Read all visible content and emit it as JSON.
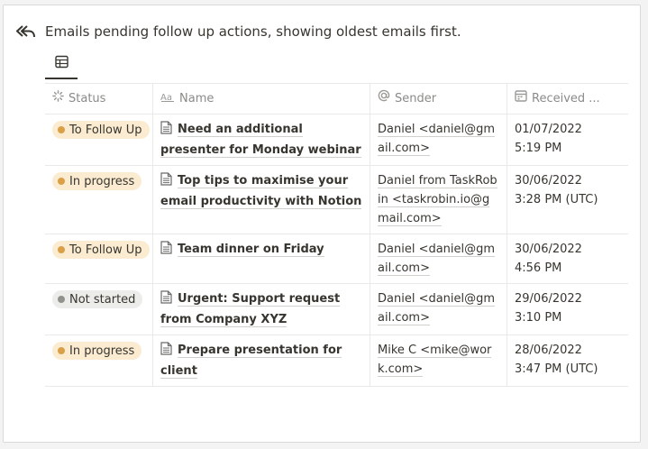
{
  "header": {
    "title": "Emails pending follow up actions, showing oldest emails first."
  },
  "icons": {
    "back": "reply-all-icon",
    "table_view": "table-icon",
    "status": "status-icon",
    "name": "text-icon",
    "sender": "at-sign-icon",
    "received": "calendar-icon",
    "page": "page-icon"
  },
  "columns": {
    "status": "Status",
    "name": "Name",
    "sender": "Sender",
    "received": "Received ..."
  },
  "colors": {
    "to_follow_up_bg": "#fbecd1",
    "to_follow_up_dot": "#d9a048",
    "in_progress_bg": "#fbecd1",
    "in_progress_dot": "#d9a048",
    "not_started_bg": "#ececea",
    "not_started_dot": "#91918e"
  },
  "rows": [
    {
      "status": "To Follow Up",
      "name": "Need an additional presenter for Monday webinar",
      "sender": "Daniel <daniel@gmail.com>",
      "received_date": "01/07/2022",
      "received_time": "5:19 PM"
    },
    {
      "status": "In progress",
      "name": "Top tips to maximise your email productivity with Notion",
      "sender": "Daniel from TaskRobin <taskrobin.io@gmail.com>",
      "received_date": "30/06/2022",
      "received_time": "3:28 PM (UTC)"
    },
    {
      "status": "To Follow Up",
      "name": "Team dinner on Friday",
      "sender": "Daniel <daniel@gmail.com>",
      "received_date": "30/06/2022",
      "received_time": "4:56 PM"
    },
    {
      "status": "Not started",
      "name": "Urgent: Support request from Company XYZ",
      "sender": "Daniel <daniel@gmail.com>",
      "received_date": "29/06/2022",
      "received_time": "3:10 PM"
    },
    {
      "status": "In progress",
      "name": "Prepare presentation for client",
      "sender": "Mike C <mike@work.com>",
      "received_date": "28/06/2022",
      "received_time": "3:47 PM (UTC)"
    }
  ]
}
